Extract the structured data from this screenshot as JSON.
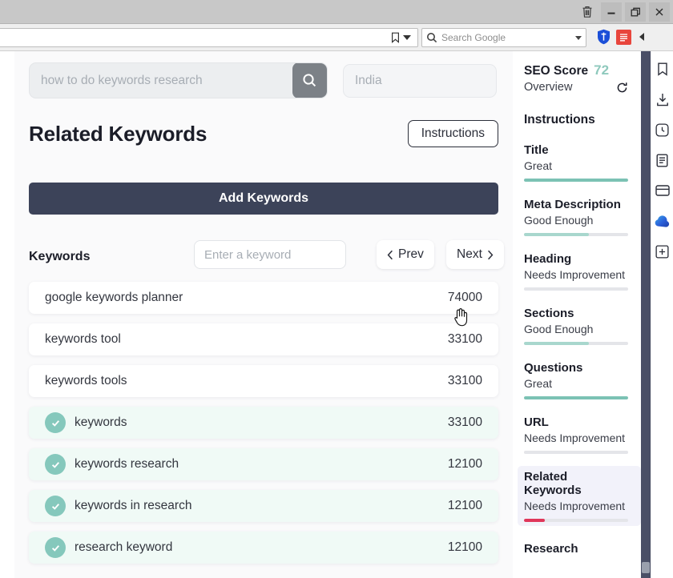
{
  "browser": {
    "window_controls": [
      {
        "name": "trash",
        "glyph": "trash-icon"
      },
      {
        "name": "minimize",
        "glyph": "minimize-icon"
      },
      {
        "name": "restore",
        "glyph": "restore-icon"
      },
      {
        "name": "close",
        "glyph": "close-icon"
      }
    ],
    "address_bar": {
      "value": "",
      "placeholder": ""
    },
    "google_search": {
      "placeholder": "Search Google",
      "value": ""
    }
  },
  "search": {
    "keyword_value": "",
    "keyword_placeholder": "how to do keywords research",
    "country_value": "",
    "country_placeholder": "India"
  },
  "main": {
    "title": "Related Keywords",
    "instructions_label": "Instructions",
    "add_keywords_label": "Add Keywords",
    "keywords_label": "Keywords",
    "keyword_input_placeholder": "Enter a keyword",
    "keyword_input_value": "",
    "prev_label": "Prev",
    "next_label": "Next",
    "rows": [
      {
        "name": "google keywords planner",
        "volume": "74000",
        "selected": false
      },
      {
        "name": "keywords tool",
        "volume": "33100",
        "selected": false
      },
      {
        "name": "keywords tools",
        "volume": "33100",
        "selected": false
      },
      {
        "name": "keywords",
        "volume": "33100",
        "selected": true
      },
      {
        "name": "keywords research",
        "volume": "12100",
        "selected": true
      },
      {
        "name": "keywords in research",
        "volume": "12100",
        "selected": true
      },
      {
        "name": "research keyword",
        "volume": "12100",
        "selected": true
      }
    ]
  },
  "seo_panel": {
    "score_label": "SEO Score",
    "score_value": "72",
    "overview_label": "Overview",
    "instructions_label": "Instructions",
    "metrics": [
      {
        "name": "Title",
        "status": "Great",
        "fill_pct": 100,
        "color": "#7cc2b4",
        "active": false
      },
      {
        "name": "Meta Description",
        "status": "Good Enough",
        "fill_pct": 62,
        "color": "#a8d7cd",
        "active": false
      },
      {
        "name": "Heading",
        "status": "Needs Improvement",
        "fill_pct": 0,
        "color": "#e4e5e9",
        "active": false
      },
      {
        "name": "Sections",
        "status": "Good Enough",
        "fill_pct": 62,
        "color": "#a8d7cd",
        "active": false
      },
      {
        "name": "Questions",
        "status": "Great",
        "fill_pct": 100,
        "color": "#7cc2b4",
        "active": false
      },
      {
        "name": "URL",
        "status": "Needs Improvement",
        "fill_pct": 0,
        "color": "#e4e5e9",
        "active": false
      },
      {
        "name": "Related Keywords",
        "status": "Needs Improvement",
        "fill_pct": 20,
        "color": "#e0365a",
        "active": true
      },
      {
        "name": "Research",
        "status": "",
        "fill_pct": 0,
        "color": "#e4e5e9",
        "active": false
      }
    ]
  },
  "rail": {
    "icons": [
      "bookmark-icon",
      "download-icon",
      "history-clock-icon",
      "notes-icon",
      "wallet-card-icon",
      "cloud-icon",
      "add-plus-icon"
    ]
  },
  "colors": {
    "accent_navy": "#3c4359",
    "accent_teal": "#85c8bc",
    "warning_red": "#e0365a",
    "rail_dark": "#4a4f66"
  }
}
